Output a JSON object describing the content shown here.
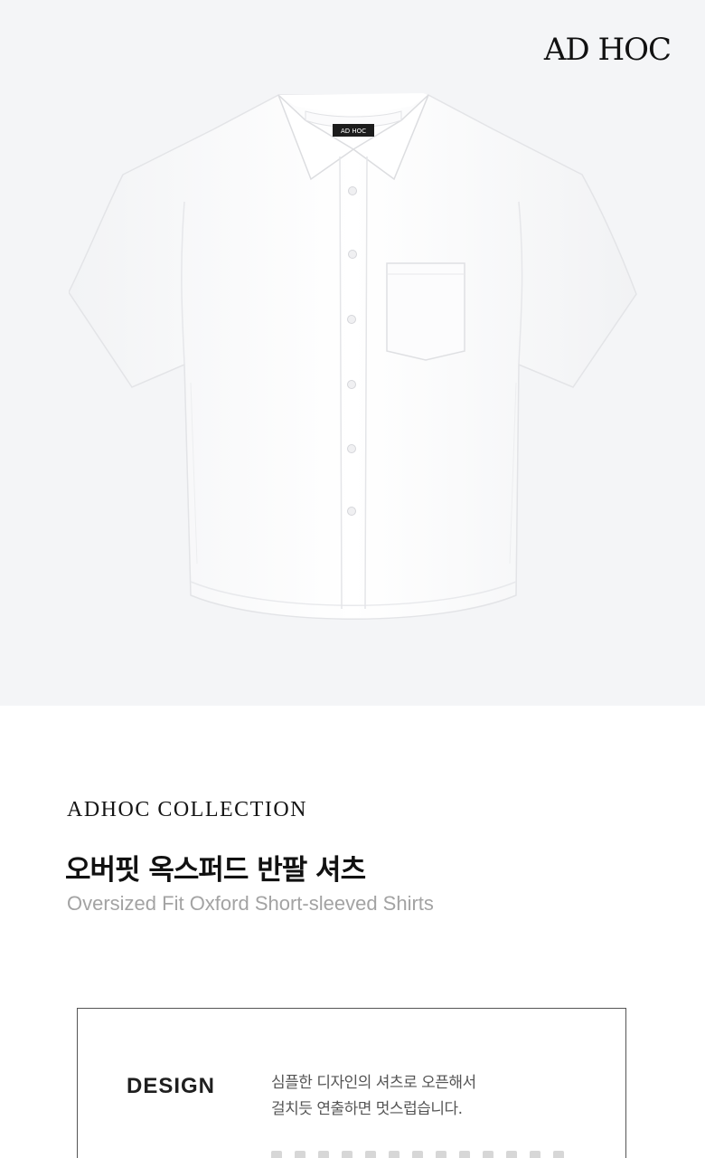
{
  "brand": {
    "logo_text": "AD HOC",
    "neck_label_text": "AD HOC"
  },
  "product": {
    "collection": "ADHOC COLLECTION",
    "title_ko": "오버핏 옥스퍼드 반팔 셔츠",
    "title_en": "Oversized Fit Oxford Short-sleeved Shirts",
    "image_alt": "white oversized oxford short-sleeved shirt"
  },
  "details": {
    "design_label": "DESIGN",
    "design_lines": [
      "심플한 디자인의 셔츠로 오픈해서",
      "걸치듯 연출하면 멋스럽습니다."
    ]
  },
  "colors": {
    "hero_background": "#f4f5f7",
    "shirt": "#fdfdfd",
    "text_primary": "#111111",
    "text_secondary": "#a3a3a3"
  }
}
